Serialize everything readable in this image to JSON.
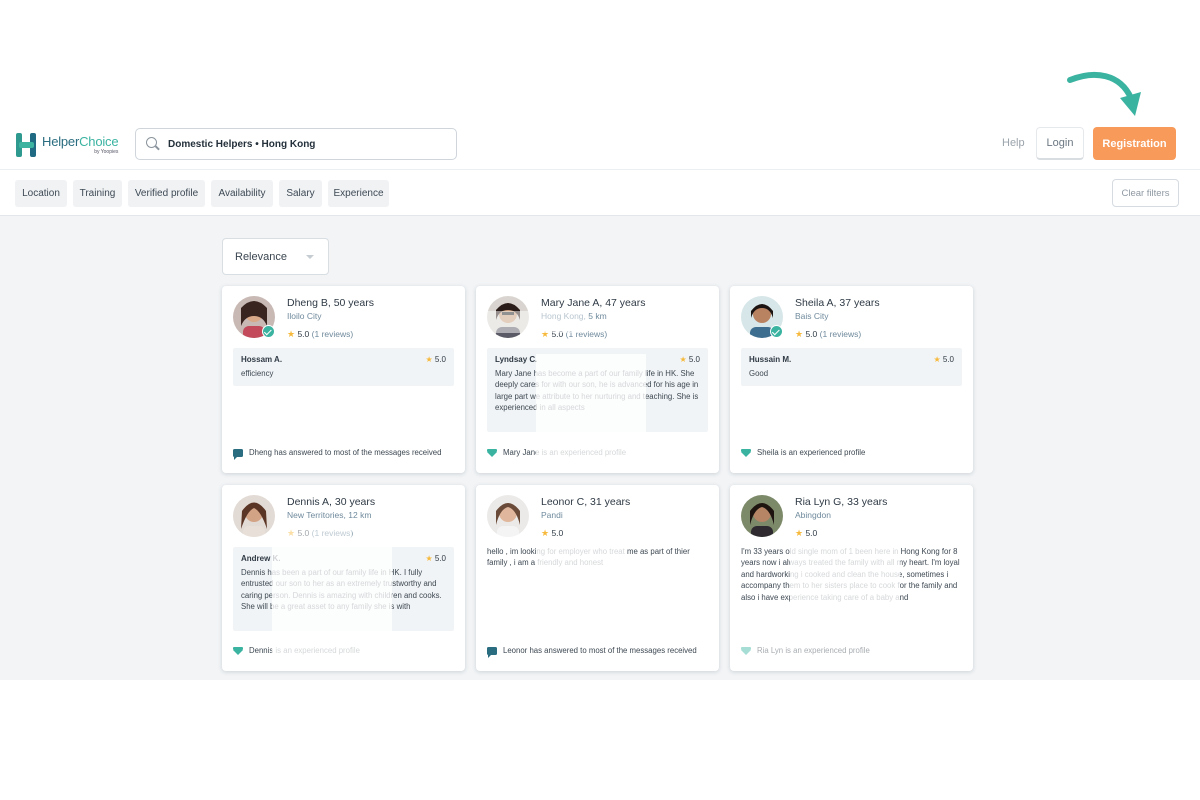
{
  "brand": {
    "name_part1": "Helper",
    "name_part2": "Choice",
    "byline": "by Yoopies"
  },
  "search": {
    "value": "Domestic Helpers • Hong Kong"
  },
  "nav": {
    "help": "Help",
    "login": "Login",
    "registration": "Registration"
  },
  "filters": {
    "chips": [
      "Location",
      "Training",
      "Verified profile",
      "Availability",
      "Salary",
      "Experience"
    ],
    "clear": "Clear filters"
  },
  "sort": {
    "selected": "Relevance"
  },
  "colors": {
    "accent": "#3bb3a1",
    "brand_dark": "#2a6d80",
    "cta": "#f79a5a",
    "star": "#f6b93b"
  },
  "cards": [
    {
      "name": "Dheng B, 50 years",
      "location": "Iloilo City",
      "rating": "5.0",
      "reviews": "(1 reviews)",
      "review": {
        "author": "Hossam A.",
        "score": "5.0",
        "text": "efficiency"
      },
      "footer": "Dheng has answered to most of the messages received",
      "footer_icon": "chat-icon"
    },
    {
      "name": "Mary Jane A, 47 years",
      "location": "Hong Kong, 5 km",
      "rating": "5.0",
      "reviews": "(1 reviews)",
      "review": {
        "author": "Lyndsay C.",
        "score": "5.0",
        "text": "Mary Jane has become a part of our family life in HK. She deeply cares for with our son, he is advanced for his age in large part we attribute to her nurturing and teaching. She is experienced in all aspects"
      },
      "footer": "Mary Jane is an experienced profile",
      "footer_icon": "diamond-icon"
    },
    {
      "name": "Sheila A, 37 years",
      "location": "Bais City",
      "rating": "5.0",
      "reviews": "(1 reviews)",
      "review": {
        "author": "Hussain M.",
        "score": "5.0",
        "text": "Good"
      },
      "footer": "Sheila is an experienced profile",
      "footer_icon": "diamond-icon"
    },
    {
      "name": "Dennis A, 30 years",
      "location": "New Territories, 12 km",
      "rating": "5.0",
      "reviews": "(1 reviews)",
      "review": {
        "author": "Andrew K.",
        "score": "5.0",
        "text": "Dennis has been a part of our family life in HK. I fully entrusted our son to her as an extremely trustworthy and caring person. Dennis is amazing with children and cooks. She will be a great asset to any family she is with"
      },
      "footer": "Dennis is an experienced profile",
      "footer_icon": "diamond-icon"
    },
    {
      "name": "Leonor C, 31 years",
      "location": "Pandi",
      "rating": "5.0",
      "about": "hello , im looking for employer who treat me as part of thier family , i am a friendly and honest",
      "footer": "Leonor has answered to most of the messages received",
      "footer_icon": "chat-icon"
    },
    {
      "name": "Ria Lyn G, 33 years",
      "location": "Abingdon",
      "rating": "5.0",
      "about": "I'm 33 years old single mom of 1 been here in Hong Kong for 8 years now i always treated the family with all my heart. I'm loyal and hardworking i cooked and clean the house, sometimes i accompany them to her sisters place to cook for the family and also i have experience taking care of a baby and",
      "footer": "Ria Lyn is an experienced profile",
      "footer_icon": "diamond-icon"
    }
  ]
}
